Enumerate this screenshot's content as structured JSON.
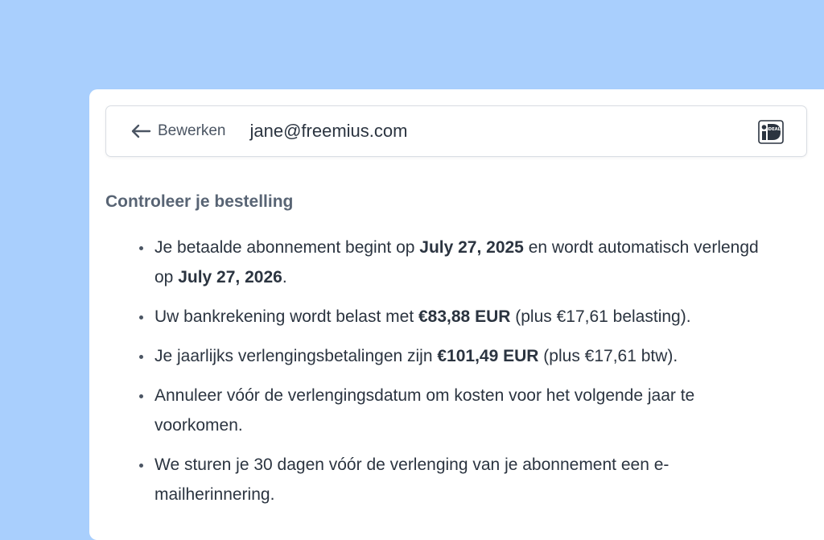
{
  "header": {
    "edit_label": "Bewerken",
    "email": "jane@freemius.com",
    "payment_icon": "ideal-logo-icon",
    "payment_badge_text": "iDEAL"
  },
  "review": {
    "title": "Controleer je bestelling",
    "items": [
      {
        "t1": "Je betaalde abonnement begint op ",
        "b1": "July 27, 2025",
        "t2": " en wordt automatisch verlengd op ",
        "b2": "July 27, 2026",
        "t3": "."
      },
      {
        "t1": "Uw bankrekening wordt belast met ",
        "b1": "€83,88 EUR",
        "t2": " (plus €17,61 belasting)."
      },
      {
        "t1": "Je jaarlijks verlengingsbetalingen zijn ",
        "b1": "€101,49 EUR",
        "t2": " (plus €17,61 btw)."
      },
      {
        "t1": "Annuleer vóór de verlengingsdatum om kosten voor het volgende jaar te voorkomen."
      },
      {
        "t1": "We sturen je 30 dagen vóór de verlenging van je abonnement een e-mailherinnering."
      }
    ]
  },
  "colors": {
    "background": "#a9cffd",
    "card": "#ffffff",
    "text": "#2b3440",
    "muted": "#586474"
  }
}
